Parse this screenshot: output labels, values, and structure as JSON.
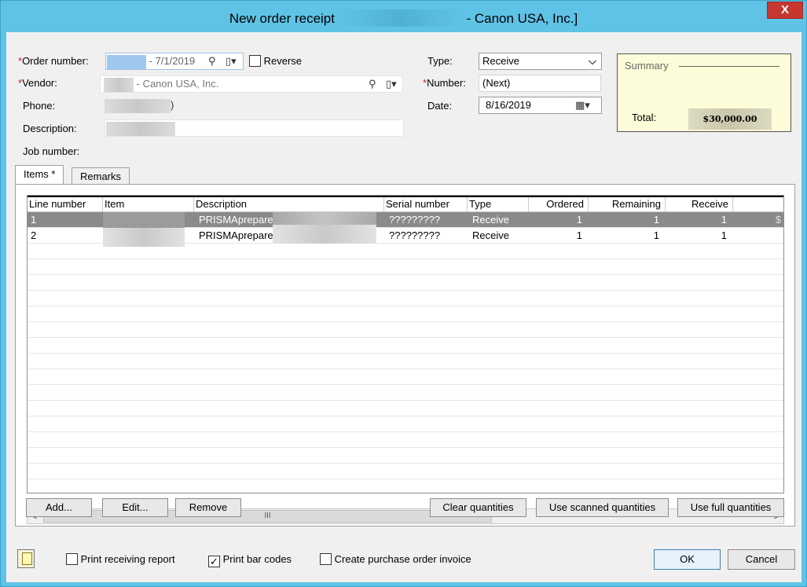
{
  "window": {
    "title_prefix": "New order receipt",
    "title_suffix": "- Canon USA, Inc.]",
    "close_label": "X"
  },
  "form": {
    "order_number_label": "Order number:",
    "order_number_value": "- 7/1/2019",
    "reverse_label": "Reverse",
    "vendor_label": "Vendor:",
    "vendor_value": "- Canon USA, Inc.",
    "phone_label": "Phone:",
    "phone_value": ")",
    "description_label": "Description:",
    "job_number_label": "Job number:",
    "type_label": "Type:",
    "type_value": "Receive",
    "number_label": "Number:",
    "number_value": "(Next)",
    "date_label": "Date:",
    "date_value": "8/16/2019",
    "required_mark": "*"
  },
  "summary": {
    "title": "Summary",
    "total_label": "Total:",
    "total_value": "$30,000.00"
  },
  "tabs": [
    {
      "label": "Items *",
      "active": true
    },
    {
      "label": "Remarks",
      "active": false
    }
  ],
  "grid": {
    "columns": [
      "Line number",
      "Item",
      "Description",
      "Serial number",
      "Type",
      "Ordered",
      "Remaining",
      "Receive"
    ],
    "rows": [
      {
        "line": "1",
        "description": "PRISMAprepare",
        "serial": "?????????",
        "type": "Receive",
        "ordered": "1",
        "remaining": "1",
        "receive": "1",
        "selected": true,
        "overflow": "$"
      },
      {
        "line": "2",
        "description": "PRISMAprepare",
        "serial": "?????????",
        "type": "Receive",
        "ordered": "1",
        "remaining": "1",
        "receive": "1",
        "selected": false
      }
    ],
    "scroll_left": "<",
    "scroll_right": ">",
    "scroll_thumb": "III"
  },
  "buttons": {
    "add": "Add...",
    "edit": "Edit...",
    "remove": "Remove",
    "clear_quantities": "Clear quantities",
    "use_scanned": "Use scanned quantities",
    "use_full": "Use full quantities",
    "ok": "OK",
    "cancel": "Cancel"
  },
  "options": {
    "print_receiving_report": {
      "label": "Print receiving report",
      "checked": false
    },
    "print_bar_codes": {
      "label": "Print bar codes",
      "checked": true
    },
    "create_po_invoice": {
      "label": "Create purchase order invoice",
      "checked": false
    }
  },
  "icons": {
    "search": "⚲",
    "lookup": "▯▾",
    "dropdown": "⌵",
    "calendar": "▦▾",
    "check": "✓"
  }
}
